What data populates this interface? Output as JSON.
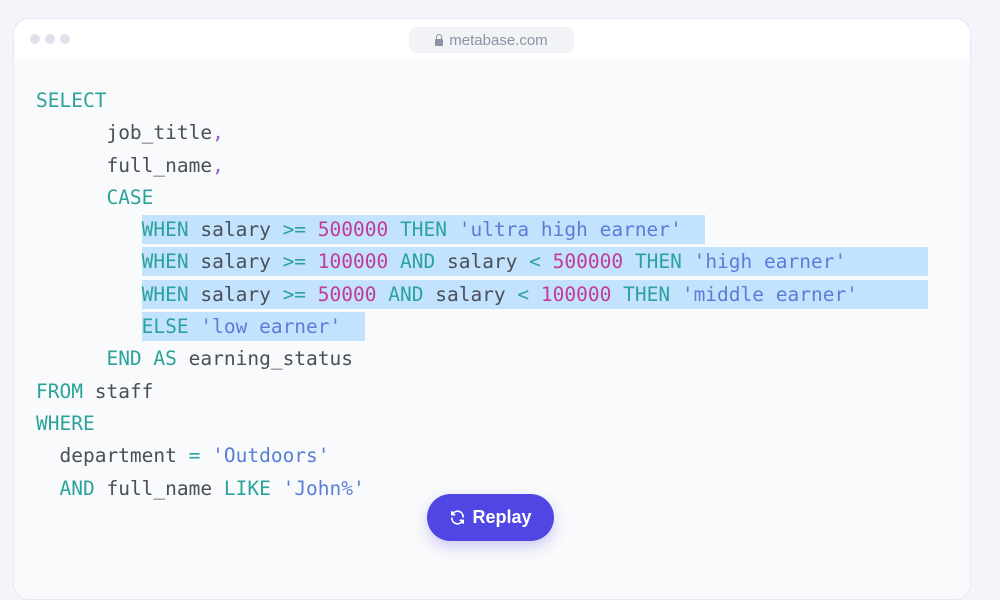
{
  "browser": {
    "url": "metabase.com"
  },
  "code": {
    "lines": [
      {
        "indent": 0,
        "hl": false,
        "tokens": [
          [
            "kw",
            "SELECT"
          ]
        ]
      },
      {
        "indent": 6,
        "hl": false,
        "tokens": [
          [
            "id",
            "job_title"
          ],
          [
            "pun",
            ","
          ]
        ]
      },
      {
        "indent": 6,
        "hl": false,
        "tokens": [
          [
            "id",
            "full_name"
          ],
          [
            "pun",
            ","
          ]
        ]
      },
      {
        "indent": 6,
        "hl": false,
        "tokens": [
          [
            "kw",
            "CASE"
          ]
        ]
      },
      {
        "indent": 9,
        "hl": true,
        "tokens": [
          [
            "kw",
            "WHEN"
          ],
          [
            "id",
            " salary "
          ],
          [
            "op",
            ">="
          ],
          [
            "id",
            " "
          ],
          [
            "num",
            "500000"
          ],
          [
            "id",
            " "
          ],
          [
            "kw",
            "THEN"
          ],
          [
            "id",
            " "
          ],
          [
            "str",
            "'ultra high earner'"
          ],
          [
            "id",
            "  "
          ]
        ]
      },
      {
        "indent": 9,
        "hl": true,
        "tokens": [
          [
            "kw",
            "WHEN"
          ],
          [
            "id",
            " salary "
          ],
          [
            "op",
            ">="
          ],
          [
            "id",
            " "
          ],
          [
            "num",
            "100000"
          ],
          [
            "id",
            " "
          ],
          [
            "kw",
            "AND"
          ],
          [
            "id",
            " salary "
          ],
          [
            "op",
            "<"
          ],
          [
            "id",
            " "
          ],
          [
            "num",
            "500000"
          ],
          [
            "id",
            " "
          ],
          [
            "kw",
            "THEN"
          ],
          [
            "id",
            " "
          ],
          [
            "str",
            "'high earner'"
          ],
          [
            "id",
            "       "
          ]
        ]
      },
      {
        "indent": 9,
        "hl": true,
        "tokens": [
          [
            "kw",
            "WHEN"
          ],
          [
            "id",
            " salary "
          ],
          [
            "op",
            ">="
          ],
          [
            "id",
            " "
          ],
          [
            "num",
            "50000"
          ],
          [
            "id",
            " "
          ],
          [
            "kw",
            "AND"
          ],
          [
            "id",
            " salary "
          ],
          [
            "op",
            "<"
          ],
          [
            "id",
            " "
          ],
          [
            "num",
            "100000"
          ],
          [
            "id",
            " "
          ],
          [
            "kw",
            "THEN"
          ],
          [
            "id",
            " "
          ],
          [
            "str",
            "'middle earner'"
          ],
          [
            "id",
            "      "
          ]
        ]
      },
      {
        "indent": 9,
        "hl": true,
        "tokens": [
          [
            "kw",
            "ELSE"
          ],
          [
            "id",
            " "
          ],
          [
            "str",
            "'low earner'"
          ],
          [
            "id",
            "  "
          ]
        ]
      },
      {
        "indent": 6,
        "hl": false,
        "tokens": [
          [
            "kw",
            "END AS"
          ],
          [
            "id",
            " earning_status"
          ]
        ]
      },
      {
        "indent": 0,
        "hl": false,
        "tokens": [
          [
            "kw",
            "FROM"
          ],
          [
            "id",
            " staff"
          ]
        ]
      },
      {
        "indent": 0,
        "hl": false,
        "tokens": [
          [
            "kw",
            "WHERE"
          ]
        ]
      },
      {
        "indent": 2,
        "hl": false,
        "tokens": [
          [
            "id",
            "department "
          ],
          [
            "op",
            "="
          ],
          [
            "id",
            " "
          ],
          [
            "str",
            "'Outdoors'"
          ]
        ]
      },
      {
        "indent": 2,
        "hl": false,
        "tokens": [
          [
            "kw",
            "AND"
          ],
          [
            "id",
            " full_name "
          ],
          [
            "kw",
            "LIKE"
          ],
          [
            "id",
            " "
          ],
          [
            "str",
            "'John%'"
          ]
        ]
      }
    ]
  },
  "replay_button": {
    "label": "Replay",
    "icon": "refresh-icon"
  }
}
